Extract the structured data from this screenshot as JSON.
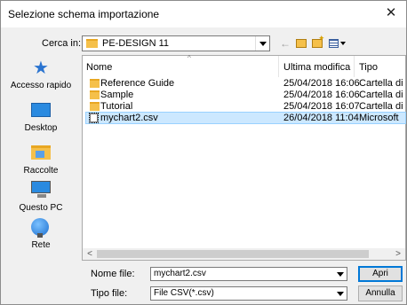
{
  "window": {
    "title": "Selezione schema importazione"
  },
  "lookin": {
    "label": "Cerca in:",
    "value": "PE-DESIGN 11"
  },
  "places": [
    {
      "label": "Accesso rapido",
      "icon": "pin-icon"
    },
    {
      "label": "Desktop",
      "icon": "desktop-icon"
    },
    {
      "label": "Raccolte",
      "icon": "libraries-icon"
    },
    {
      "label": "Questo PC",
      "icon": "computer-icon"
    },
    {
      "label": "Rete",
      "icon": "network-icon"
    }
  ],
  "columns": {
    "name": "Nome",
    "modified": "Ultima modifica",
    "type": "Tipo"
  },
  "files": [
    {
      "name": "Reference Guide",
      "modified": "25/04/2018 16:06",
      "type": "Cartella di",
      "kind": "folder"
    },
    {
      "name": "Sample",
      "modified": "25/04/2018 16:06",
      "type": "Cartella di",
      "kind": "folder"
    },
    {
      "name": "Tutorial",
      "modified": "25/04/2018 16:07",
      "type": "Cartella di",
      "kind": "folder"
    },
    {
      "name": "mychart2.csv",
      "modified": "26/04/2018 11:04",
      "type": "Microsoft",
      "kind": "file",
      "selected": true
    }
  ],
  "filename": {
    "label": "Nome file:",
    "value": "mychart2.csv"
  },
  "filetype": {
    "label": "Tipo file:",
    "value": "File CSV(*.csv)"
  },
  "buttons": {
    "open": "Apri",
    "cancel": "Annulla"
  },
  "icons": {
    "close": "✕",
    "back": "←",
    "scroll_left": "<",
    "scroll_right": ">"
  }
}
